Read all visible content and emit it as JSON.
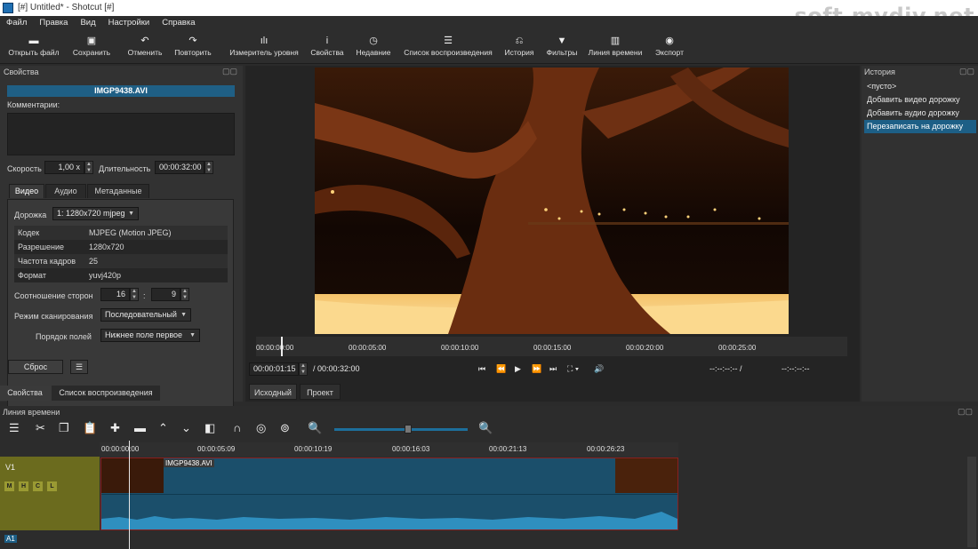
{
  "window": {
    "title": "[#] Untitled* - Shotcut [#]",
    "watermark": "soft.mydiv.net"
  },
  "menu": [
    "Файл",
    "Правка",
    "Вид",
    "Настройки",
    "Справка"
  ],
  "toolbar": {
    "open": "Открыть файл",
    "save": "Сохранить",
    "undo": "Отменить",
    "redo": "Повторить",
    "meter": "Измеритель уровня",
    "properties": "Свойства",
    "recent": "Недавние",
    "playlist": "Список воспроизведения",
    "history": "История",
    "filters": "Фильтры",
    "timeline": "Линия времени",
    "export": "Экспорт"
  },
  "props": {
    "title": "Свойства",
    "filename": "IMGP9438.AVI",
    "comments_label": "Комментарии:",
    "speed_label": "Скорость",
    "speed_value": "1,00 x",
    "duration_label": "Длительность",
    "duration_value": "00:00:32:00",
    "tabs": [
      "Видео",
      "Аудио",
      "Метаданные"
    ],
    "track_label": "Дорожка",
    "track_value": "1: 1280x720 mjpeg",
    "info": [
      {
        "k": "Кодек",
        "v": "MJPEG (Motion JPEG)"
      },
      {
        "k": "Разрешение",
        "v": "1280x720"
      },
      {
        "k": "Частота кадров",
        "v": "25"
      },
      {
        "k": "Формат",
        "v": "yuvj420p"
      }
    ],
    "aspect_label": "Соотношение сторон",
    "aspect_w": "16",
    "aspect_sep": ":",
    "aspect_h": "9",
    "scan_label": "Режим сканирования",
    "scan_value": "Последовательный",
    "field_label": "Порядок полей",
    "field_value": "Нижнее поле первое",
    "reset": "Сброс",
    "bottom_tabs": [
      "Свойства",
      "Список воспроизведения"
    ]
  },
  "player": {
    "ruler": [
      "00:00:00:00",
      "00:00:05:00",
      "00:00:10:00",
      "00:00:15:00",
      "00:00:20:00",
      "00:00:25:00"
    ],
    "position": "00:00:01:15",
    "total": "/ 00:00:32:00",
    "in_point": "--:--:--:-- /",
    "out_point": "--:--:--:--",
    "tabs": [
      "Исходный",
      "Проект"
    ]
  },
  "history": {
    "title": "История",
    "items": [
      "<пусто>",
      "Добавить видео дорожку",
      "Добавить аудио дорожку",
      "Перезаписать на дорожку"
    ],
    "selected_index": 3
  },
  "timeline": {
    "title": "Линия времени",
    "ruler": [
      "00:00:00:00",
      "00:00:05:09",
      "00:00:10:19",
      "00:00:16:03",
      "00:00:21:13",
      "00:00:26:23"
    ],
    "track_v": "V1",
    "track_a": "A1",
    "mhcl": [
      "M",
      "H",
      "C",
      "L"
    ],
    "clip_name": "IMGP9438.AVI"
  },
  "colors": {
    "accent": "#1d5f86",
    "clip": "#1b4f6b",
    "track_head": "#6b6b1e"
  }
}
